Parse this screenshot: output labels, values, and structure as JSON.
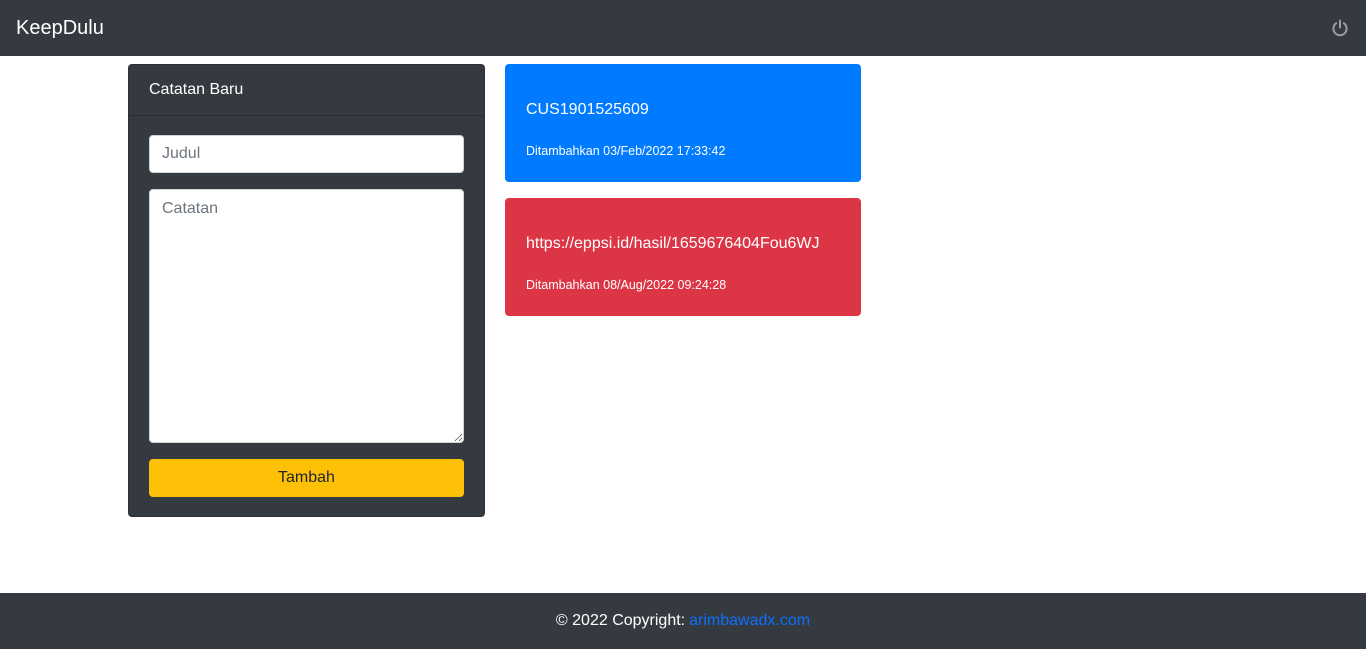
{
  "navbar": {
    "brand": "KeepDulu",
    "logout_icon": "power-icon"
  },
  "form": {
    "header": "Catatan Baru",
    "title_placeholder": "Judul",
    "note_placeholder": "Catatan",
    "submit_label": "Tambah"
  },
  "notes": [
    {
      "title": "CUS1901525609",
      "date": "Ditambahkan 03/Feb/2022 17:33:42",
      "color": "#007bff"
    },
    {
      "title": "https://eppsi.id/hasil/1659676404Fou6WJ",
      "date": "Ditambahkan 08/Aug/2022 09:24:28",
      "color": "#dc3545"
    }
  ],
  "footer": {
    "copyright": "© 2022 Copyright:",
    "link_text": "arimbawadx.com"
  },
  "colors": {
    "dark": "#343a40",
    "warning": "#ffc107",
    "link": "#0d6efd"
  }
}
